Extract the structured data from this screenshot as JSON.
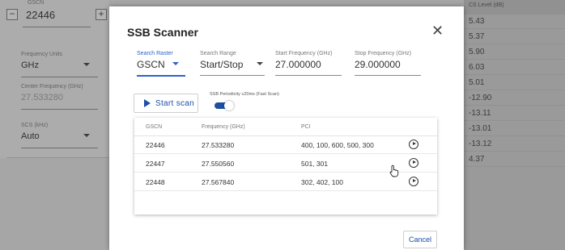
{
  "background": {
    "gscn_label": "GSCN",
    "gscn_value": "22446",
    "minus": "−",
    "plus": "+",
    "fields": [
      {
        "label": "Frequency Units",
        "value": "GHz"
      },
      {
        "label": "Center Frequency (GHz)",
        "value": "27.533280"
      },
      {
        "label": "SCS (kHz)",
        "value": "Auto"
      }
    ],
    "right_header": "CS Level (dB)",
    "right_values": [
      "5.43",
      "5.37",
      "5.90",
      "6.03",
      "5.01",
      "-12.90",
      "-13.11",
      "-13.01",
      "-13.12",
      "4.37"
    ]
  },
  "dialog": {
    "title": "SSB Scanner",
    "close": "✕",
    "search_raster": {
      "label": "Search Raster",
      "value": "GSCN"
    },
    "search_range": {
      "label": "Search Range",
      "value": "Start/Stop"
    },
    "start_frequency": {
      "label": "Start Frequency (GHz)",
      "value": "27.000000"
    },
    "stop_frequency": {
      "label": "Stop Frequency (GHz)",
      "value": "29.000000"
    },
    "start_scan_label": "Start scan",
    "periodicity_label": "SSB Periodicity ≤20ms (Fast Scan)",
    "periodicity_on": true,
    "columns": [
      "GSCN",
      "Frequency (GHz)",
      "PCI"
    ],
    "rows": [
      {
        "gscn": "22446",
        "freq": "27.533280",
        "pci": "400, 100, 600, 500, 300"
      },
      {
        "gscn": "22447",
        "freq": "27.550560",
        "pci": "501, 301"
      },
      {
        "gscn": "22448",
        "freq": "27.567840",
        "pci": "302, 402, 100"
      }
    ],
    "cancel_label": "Cancel"
  },
  "colors": {
    "accent": "#2b63c8",
    "button_text": "#1d4fa8",
    "toggle": "#1f4fa3"
  }
}
